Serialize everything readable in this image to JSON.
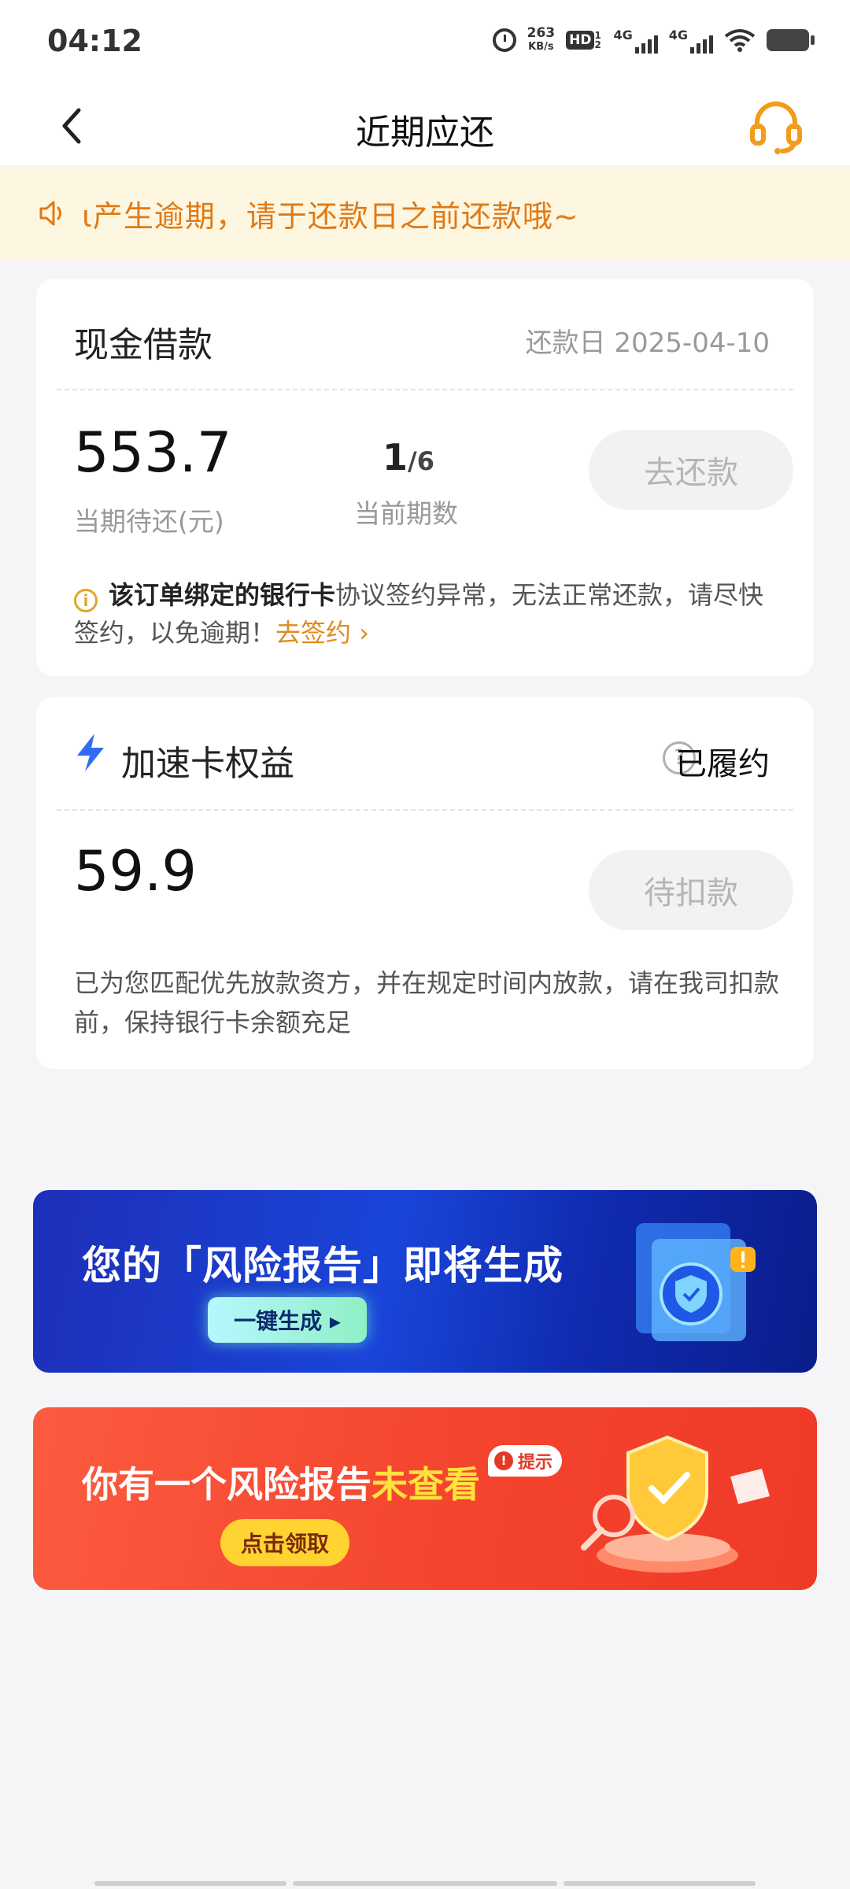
{
  "status_bar": {
    "time": "04:12",
    "speed_value": "263",
    "speed_unit": "KB/s",
    "hd": "HD",
    "hd_sub": "1 2",
    "net1": "4G",
    "net2": "4G"
  },
  "navbar": {
    "title": "近期应还"
  },
  "notice": {
    "text": "ɩ产生逾期，请于还款日之前还款哦~"
  },
  "loan_card": {
    "title": "现金借款",
    "due_date": "还款日 2025-04-10",
    "amount": "553.7",
    "amount_label": "当期待还(元)",
    "period_current": "1",
    "period_total": "/6",
    "period_label": "当前期数",
    "repay_button": "去还款",
    "warning_bold": "该订单绑定的银行卡",
    "warning_text": "协议签约异常，无法正常还款，请尽快签约，以免逾期！",
    "warning_link": "去签约 ›"
  },
  "speed_card": {
    "title": "加速卡权益",
    "status": "已履约",
    "amount": "59.9",
    "button": "待扣款",
    "description": "已为您匹配优先放款资方，并在规定时间内放款，请在我司扣款前，保持银行卡余额充足"
  },
  "banner_risk_report": {
    "title_pre": "您的",
    "title_hl": "「风险报告」",
    "title_post": "即将生成",
    "button": "一键生成 ▸"
  },
  "banner_unviewed": {
    "title_pre": "你有一个风险报告",
    "title_hl": "未查看",
    "tag": "提示",
    "button": "点击领取"
  },
  "colors": {
    "accent_orange": "#e07a16",
    "notice_bg": "#fdf6e0",
    "banner_blue": "#1a45d8",
    "banner_red": "#f4442e"
  }
}
